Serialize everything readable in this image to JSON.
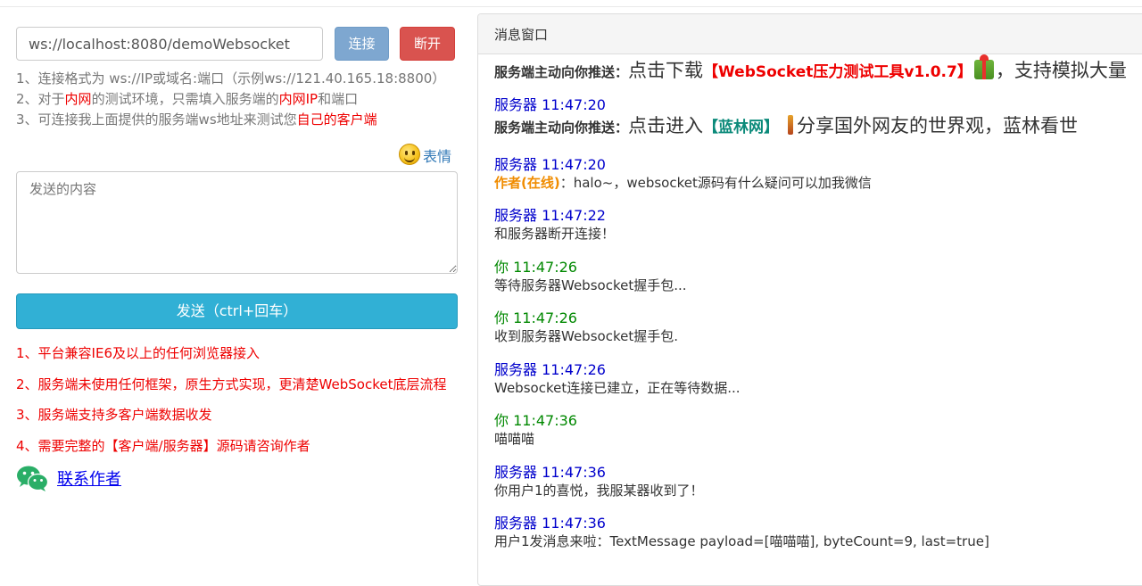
{
  "connect": {
    "url_value": "ws://localhost:8080/demoWebsocket",
    "connect_label": "连接",
    "disconnect_label": "断开"
  },
  "tips": {
    "line1": "1、连接格式为 ws://IP或域名:端口（示例ws://121.40.165.18:8800）",
    "line2_a": "2、对于",
    "line2_b": "内网",
    "line2_c": "的测试环境，只需填入服务端的",
    "line2_d": "内网IP",
    "line2_e": "和端口",
    "line3_a": "3、可连接我上面提供的服务端ws地址来测试您",
    "line3_b": "自己的客户端"
  },
  "emoji": {
    "label": "表情",
    "icon": "smiley-icon"
  },
  "composer": {
    "placeholder": "发送的内容",
    "send_label": "发送（ctrl+回车）"
  },
  "features": [
    "1、平台兼容IE6及以上的任何浏览器接入",
    "2、服务端未使用任何框架，原生方式实现，更清楚WebSocket底层流程",
    "3、服务端支持多客户端数据收发",
    "4、需要完整的【客户端/服务器】源码请咨询作者"
  ],
  "contact": {
    "label": "联系作者",
    "icon": "wechat-icon"
  },
  "panel": {
    "title": "消息窗口",
    "messages": [
      {
        "kind": "push",
        "prefix": "服务端主动向你推送：",
        "text_a": "点击下载",
        "highlight": "【WebSocket压力测试工具v1.0.7】",
        "text_b": "，支持模拟大量"
      },
      {
        "kind": "server",
        "meta": "服务器 11:47:20"
      },
      {
        "kind": "push",
        "prefix": "服务端主动向你推送：",
        "text_a": "点击进入",
        "highlight": "【蓝林网】",
        "text_b": "分享国外网友的世界观，蓝林看世"
      },
      {
        "kind": "server",
        "meta": "服务器 11:47:20",
        "author": "作者(在线)",
        "body": "：halo~，websocket源码有什么疑问可以加我微信"
      },
      {
        "kind": "server",
        "meta": "服务器 11:47:22",
        "body": "和服务器断开连接！"
      },
      {
        "kind": "you",
        "meta": "你 11:47:26",
        "body": "等待服务器Websocket握手包..."
      },
      {
        "kind": "you",
        "meta": "你 11:47:26",
        "body": "收到服务器Websocket握手包."
      },
      {
        "kind": "server",
        "meta": "服务器 11:47:26",
        "body": "Websocket连接已建立，正在等待数据..."
      },
      {
        "kind": "you",
        "meta": "你 11:47:36",
        "body": "喵喵喵"
      },
      {
        "kind": "server",
        "meta": "服务器 11:47:36",
        "body": "你用户1的喜悦，我服某器收到了！"
      },
      {
        "kind": "server",
        "meta": "服务器 11:47:36",
        "body": "用户1发消息来啦：TextMessage payload=[喵喵喵], byteCount=9, last=true]"
      }
    ]
  },
  "colors": {
    "connect": "#7ea7d0",
    "disconnect": "#d9534f",
    "send": "#31b0d5",
    "server_meta": "#0000cc",
    "you_meta": "#008800",
    "warning_text": "#e00000"
  }
}
